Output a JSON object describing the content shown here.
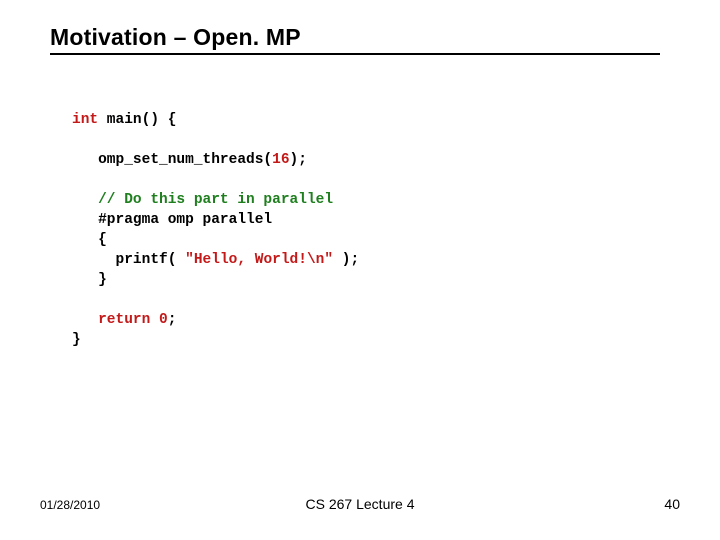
{
  "slide": {
    "title": "Motivation – Open. MP"
  },
  "code": {
    "kw_int": "int",
    "fn_sig": " main() {",
    "indent1": "   ",
    "indent2": "     ",
    "set_threads_pre": "omp_set_num_threads(",
    "set_threads_num": "16",
    "set_threads_post": ");",
    "comment": "// Do this part in parallel",
    "pragma": "#pragma omp parallel",
    "brace_open": "{",
    "printf_pre": "printf( ",
    "printf_str": "\"Hello, World!\\n\"",
    "printf_post": " );",
    "brace_close": "}",
    "kw_return": "return",
    "return_sp": " ",
    "return_num": "0",
    "return_post": ";",
    "close_main": "}"
  },
  "footer": {
    "date": "01/28/2010",
    "course": "CS 267 Lecture 4",
    "page": "40"
  }
}
